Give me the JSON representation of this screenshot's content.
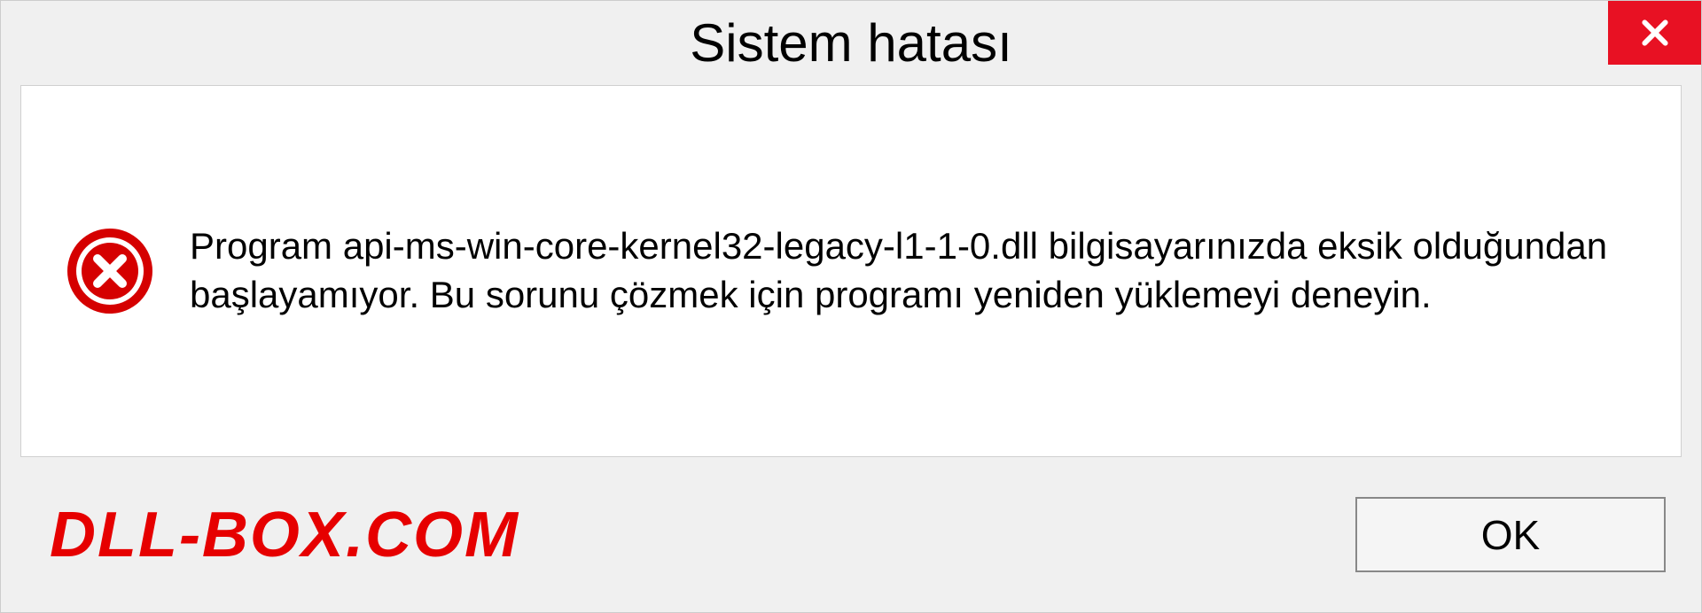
{
  "dialog": {
    "title": "Sistem hatası",
    "message": "Program api-ms-win-core-kernel32-legacy-l1-1-0.dll bilgisayarınızda eksik olduğundan başlayamıyor. Bu sorunu çözmek için programı yeniden yüklemeyi deneyin.",
    "ok_label": "OK"
  },
  "watermark": "DLL-BOX.COM",
  "colors": {
    "close_bg": "#e81123",
    "error_red": "#d50000",
    "watermark_red": "#e60000"
  }
}
